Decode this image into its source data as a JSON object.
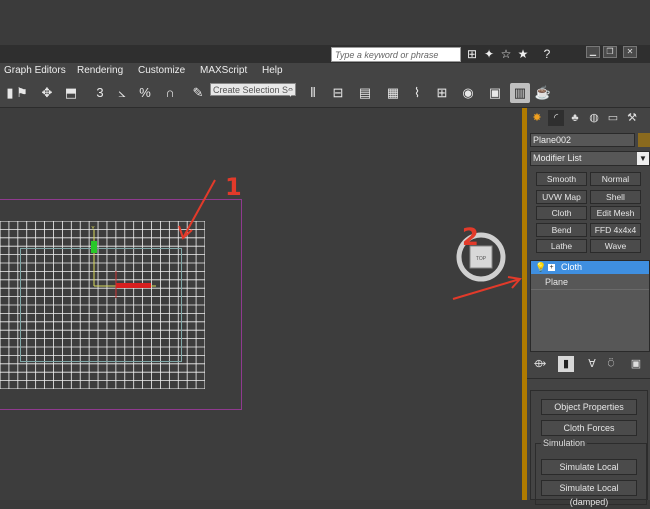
{
  "window": {
    "search_placeholder": "Type a keyword or phrase",
    "icons": [
      "binoculars-icon",
      "favorites-icon",
      "star-icon",
      "help-icon"
    ],
    "buttons": [
      "minimize",
      "restore",
      "close"
    ]
  },
  "menubar": {
    "items": [
      "Graph Editors",
      "Rendering",
      "Customize",
      "MAXScript",
      "Help"
    ]
  },
  "toolbar": {
    "selection_set": "Create Selection Se"
  },
  "viewport": {
    "navcube_label": "TOP",
    "annotations": [
      "1",
      "2"
    ]
  },
  "command_panel": {
    "object_name": "Plane002",
    "object_color": "#8a6a1e",
    "modifier_list": "Modifier List",
    "modifier_buttons": [
      "Smooth",
      "Normal",
      "UVW Map",
      "Shell",
      "Cloth",
      "Edit Mesh",
      "Bend",
      "FFD 4x4x4",
      "Lathe",
      "Wave"
    ],
    "stack": [
      "Cloth",
      "Plane"
    ],
    "rollout": {
      "object_properties": "Object Properties",
      "cloth_forces": "Cloth Forces",
      "simulation_label": "Simulation",
      "simulate_local": "Simulate Local",
      "simulate_local_damped": "Simulate Local (damped)"
    }
  },
  "colors": {
    "accent": "#b07b00",
    "selection": "#3f8fe0",
    "annotation": "#e23a2a",
    "bounding_box": "#8f3a8f"
  }
}
